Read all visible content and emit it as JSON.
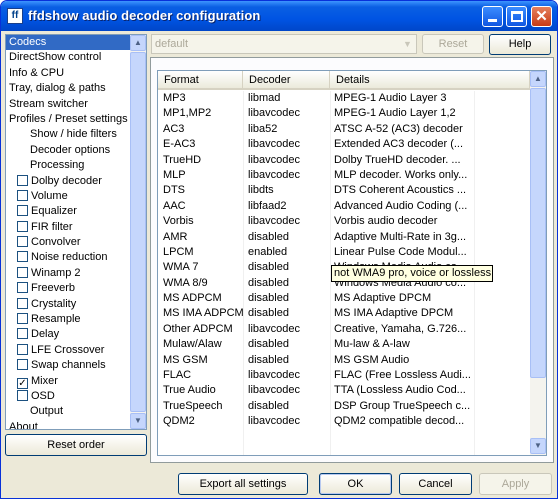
{
  "window": {
    "title": "ffdshow audio decoder configuration"
  },
  "nav": {
    "items": [
      {
        "label": "Codecs",
        "indent": 0,
        "selected": true
      },
      {
        "label": "DirectShow control",
        "indent": 0
      },
      {
        "label": "Info & CPU",
        "indent": 0
      },
      {
        "label": "Tray, dialog & paths",
        "indent": 0
      },
      {
        "label": "Stream switcher",
        "indent": 0
      },
      {
        "label": "Profiles / Preset settings",
        "indent": 0
      },
      {
        "label": "Show / hide filters",
        "indent": 1
      },
      {
        "label": "Decoder options",
        "indent": 1
      },
      {
        "label": "Processing",
        "indent": 1
      },
      {
        "label": "Dolby decoder",
        "indent": 1,
        "checkbox": true,
        "checked": false
      },
      {
        "label": "Volume",
        "indent": 1,
        "checkbox": true,
        "checked": false
      },
      {
        "label": "Equalizer",
        "indent": 1,
        "checkbox": true,
        "checked": false
      },
      {
        "label": "FIR filter",
        "indent": 1,
        "checkbox": true,
        "checked": false
      },
      {
        "label": "Convolver",
        "indent": 1,
        "checkbox": true,
        "checked": false
      },
      {
        "label": "Noise reduction",
        "indent": 1,
        "checkbox": true,
        "checked": false
      },
      {
        "label": "Winamp 2",
        "indent": 1,
        "checkbox": true,
        "checked": false
      },
      {
        "label": "Freeverb",
        "indent": 1,
        "checkbox": true,
        "checked": false
      },
      {
        "label": "Crystality",
        "indent": 1,
        "checkbox": true,
        "checked": false
      },
      {
        "label": "Resample",
        "indent": 1,
        "checkbox": true,
        "checked": false
      },
      {
        "label": "Delay",
        "indent": 1,
        "checkbox": true,
        "checked": false
      },
      {
        "label": "LFE Crossover",
        "indent": 1,
        "checkbox": true,
        "checked": false
      },
      {
        "label": "Swap channels",
        "indent": 1,
        "checkbox": true,
        "checked": false
      },
      {
        "label": "Mixer",
        "indent": 1,
        "checkbox": true,
        "checked": true
      },
      {
        "label": "OSD",
        "indent": 1,
        "checkbox": true,
        "checked": false
      },
      {
        "label": "Output",
        "indent": 1
      },
      {
        "label": "About",
        "indent": 0
      }
    ],
    "reset_order_label": "Reset order"
  },
  "preset": {
    "value": "default",
    "reset_label": "Reset",
    "help_label": "Help"
  },
  "table": {
    "headers": [
      "Format",
      "Decoder",
      "Details"
    ],
    "rows": [
      [
        "MP3",
        "libmad",
        "MPEG-1 Audio Layer 3"
      ],
      [
        "MP1,MP2",
        "libavcodec",
        "MPEG-1 Audio Layer 1,2"
      ],
      [
        "AC3",
        "liba52",
        "ATSC A-52 (AC3) decoder"
      ],
      [
        "E-AC3",
        "libavcodec",
        "Extended AC3 decoder (..."
      ],
      [
        "TrueHD",
        "libavcodec",
        "Dolby TrueHD decoder. ..."
      ],
      [
        "MLP",
        "libavcodec",
        "MLP decoder. Works only..."
      ],
      [
        "DTS",
        "libdts",
        "DTS Coherent Acoustics ..."
      ],
      [
        "AAC",
        "libfaad2",
        "Advanced Audio Coding (..."
      ],
      [
        "Vorbis",
        "libavcodec",
        "Vorbis audio decoder"
      ],
      [
        "AMR",
        "disabled",
        "Adaptive Multi-Rate in 3g..."
      ],
      [
        "LPCM",
        "enabled",
        "Linear Pulse Code Modul..."
      ],
      [
        "WMA 7",
        "disabled",
        "Windows Media Audio co..."
      ],
      [
        "WMA 8/9",
        "disabled",
        "Windows Media Audio co..."
      ],
      [
        "MS ADPCM",
        "disabled",
        "MS Adaptive DPCM"
      ],
      [
        "MS IMA ADPCM",
        "disabled",
        "MS IMA Adaptive DPCM"
      ],
      [
        "Other ADPCM",
        "libavcodec",
        "Creative, Yamaha, G.726..."
      ],
      [
        "Mulaw/Alaw",
        "disabled",
        "Mu-law & A-law"
      ],
      [
        "MS GSM",
        "disabled",
        "MS GSM Audio"
      ],
      [
        "FLAC",
        "libavcodec",
        "FLAC (Free Lossless Audi..."
      ],
      [
        "True Audio",
        "libavcodec",
        "TTA (Lossless Audio Cod..."
      ],
      [
        "TrueSpeech",
        "disabled",
        "DSP Group TrueSpeech c..."
      ],
      [
        "QDM2",
        "libavcodec",
        "QDM2 compatible decod..."
      ]
    ],
    "tooltip": "not WMA9 pro, voice or lossless"
  },
  "buttons": {
    "export": "Export all settings",
    "ok": "OK",
    "cancel": "Cancel",
    "apply": "Apply"
  },
  "colors": {
    "titlebar": "#0054e3",
    "selection": "#316ac5",
    "tooltip_bg": "#ffffe1"
  }
}
